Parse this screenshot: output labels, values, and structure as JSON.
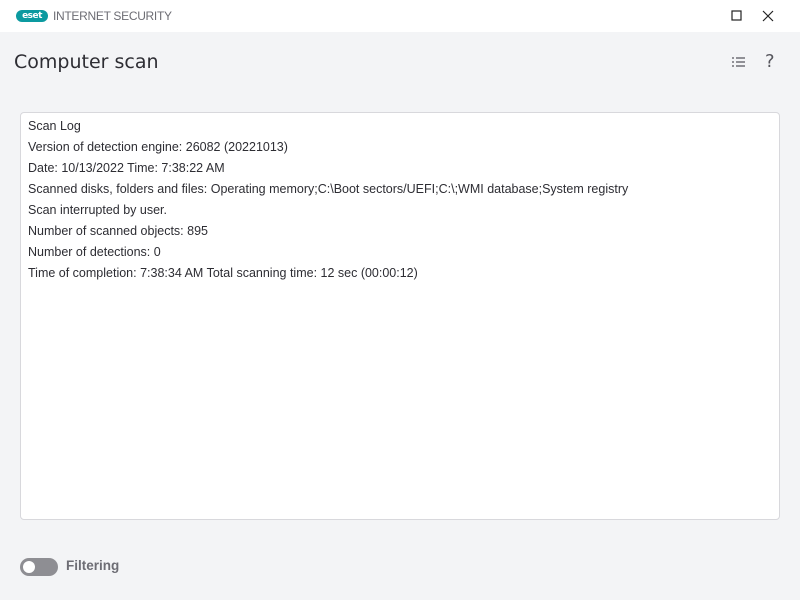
{
  "app": {
    "logo": "eset",
    "product": "INTERNET SECURITY"
  },
  "window": {
    "maximize_icon": "square-icon",
    "close_icon": "close-icon"
  },
  "header": {
    "title": "Computer scan",
    "list_icon": "list-icon",
    "help_label": "?"
  },
  "log": {
    "lines": [
      "Scan Log",
      "Version of detection engine: 26082 (20221013)",
      "Date: 10/13/2022  Time: 7:38:22 AM",
      "Scanned disks, folders and files: Operating memory;C:\\Boot sectors/UEFI;C:\\;WMI database;System registry",
      "Scan interrupted by user.",
      "Number of scanned objects: 895",
      "Number of detections: 0",
      "Time of completion: 7:38:34 AM  Total scanning time: 12 sec (00:00:12)"
    ]
  },
  "footer": {
    "filtering_label": "Filtering",
    "filtering_on": false
  }
}
